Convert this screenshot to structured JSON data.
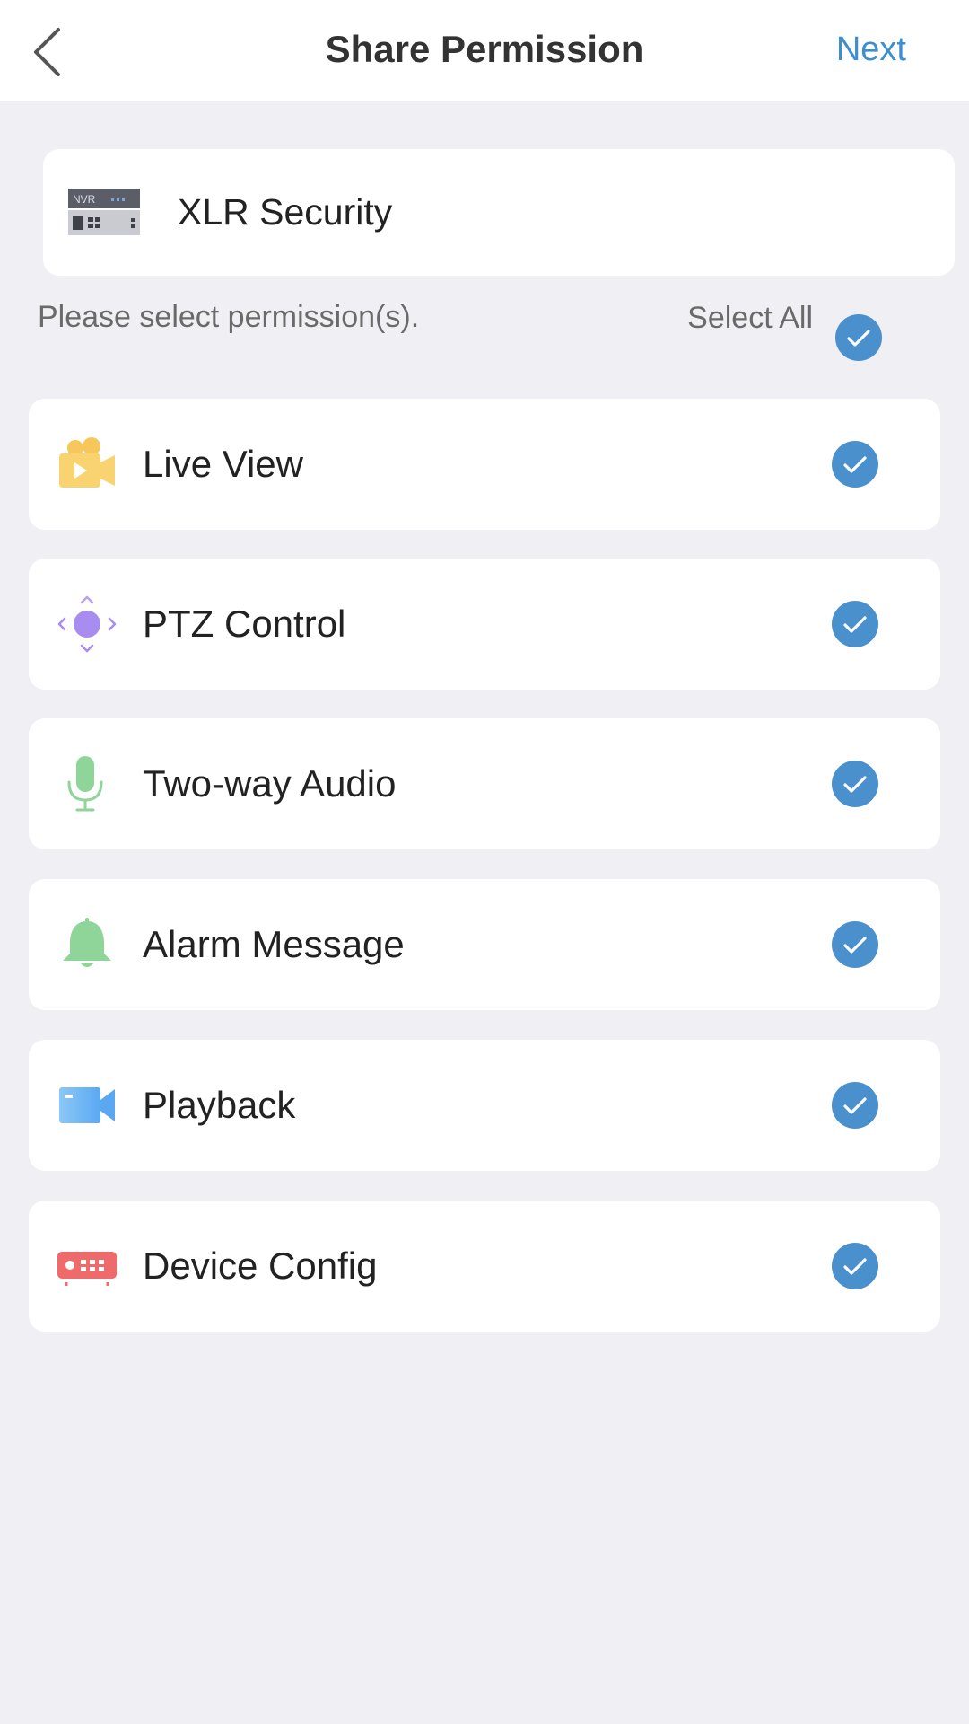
{
  "header": {
    "back_icon": "chevron-left-icon",
    "title": "Share Permission",
    "next_label": "Next"
  },
  "device": {
    "icon": "nvr-icon",
    "name": "XLR Security"
  },
  "permissions_section": {
    "hint": "Please select permission(s).",
    "select_all_label": "Select All",
    "select_all_checked": true
  },
  "permissions": [
    {
      "label": "Live View",
      "icon": "live-view-camera-icon",
      "checked": true
    },
    {
      "label": "PTZ Control",
      "icon": "ptz-control-icon",
      "checked": true
    },
    {
      "label": "Two-way Audio",
      "icon": "microphone-icon",
      "checked": true
    },
    {
      "label": "Alarm Message",
      "icon": "bell-icon",
      "checked": true
    },
    {
      "label": "Playback",
      "icon": "video-camera-icon",
      "checked": true
    },
    {
      "label": "Device Config",
      "icon": "device-config-icon",
      "checked": true
    }
  ],
  "colors": {
    "accent": "#3d8fd0",
    "check": "#4a90cc",
    "background": "#efeff4",
    "card": "#ffffff"
  }
}
